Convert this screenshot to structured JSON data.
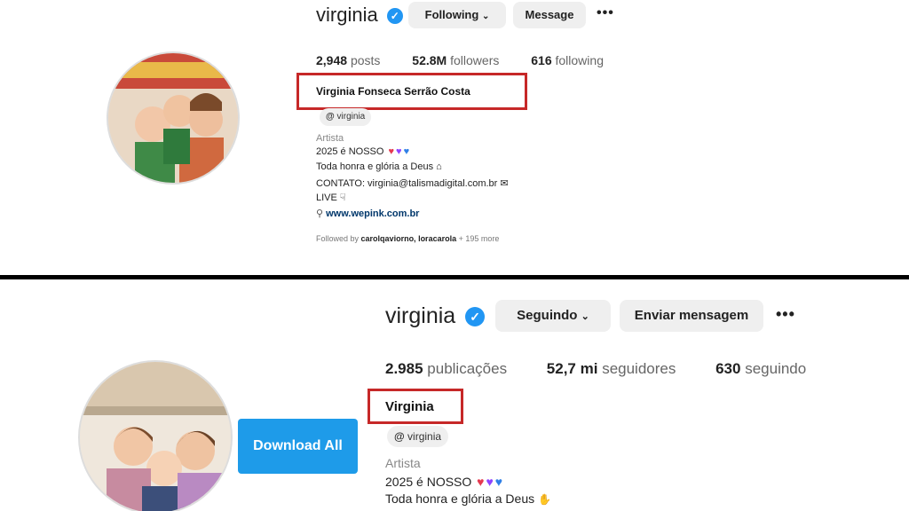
{
  "top": {
    "username": "virginia",
    "follow_label": "Following",
    "message_label": "Message",
    "more_label": "•••",
    "stats": [
      {
        "value": "2,948",
        "label": "posts"
      },
      {
        "value": "52.8M",
        "label": "followers"
      },
      {
        "value": "616",
        "label": "following"
      }
    ],
    "full_name": "Virginia Fonseca Serrão Costa",
    "threads_handle": "virginia",
    "category": "Artista",
    "bio": [
      "2025 é NOSSO",
      "Toda honra e glória a Deus",
      "CONTATO: virginia@talismadigital.com.br",
      "LIVE"
    ],
    "link": "www.wepink.com.br",
    "followed_by_prefix": "Followed by",
    "followed_by_names": "carolqaviorno, loracarola",
    "followed_by_more": "+ 195 more"
  },
  "bottom": {
    "username": "virginia",
    "follow_label": "Seguindo",
    "message_label": "Enviar mensagem",
    "more_label": "•••",
    "stats": [
      {
        "value": "2.985",
        "label": "publicações"
      },
      {
        "value": "52,7 mi",
        "label": "seguidores"
      },
      {
        "value": "630",
        "label": "seguindo"
      }
    ],
    "full_name": "Virginia",
    "threads_handle": "virginia",
    "category": "Artista",
    "bio": [
      "2025 é NOSSO",
      "Toda honra e glória a Deus"
    ],
    "download_label": "Download All"
  },
  "colors": {
    "highlight_box": "#c62828",
    "verified": "#2196f3",
    "download_button": "#1e9be9",
    "heart_red": "#e53950",
    "heart_purple": "#8e44ff",
    "heart_blue": "#2f7fe6"
  }
}
